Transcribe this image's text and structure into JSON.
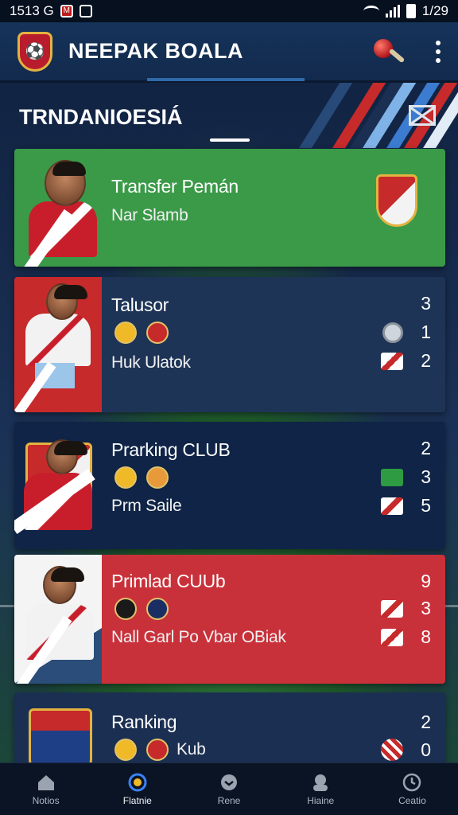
{
  "status_bar": {
    "left_text": "1513 G",
    "time": "1/29"
  },
  "app": {
    "title": "NEEPAK BOALA"
  },
  "section": {
    "title": "TRNDANIOESIÁ"
  },
  "cards": [
    {
      "title": "Transfer Pemán",
      "subtitle": "Nar Slamb",
      "color": "#3a9a48",
      "stats": []
    },
    {
      "title": "Talusor",
      "subtitle": "Huk Ulatok",
      "color": "#1e3456",
      "stats": [
        "3",
        "1",
        "2"
      ]
    },
    {
      "title": "Prarking CLUB",
      "subtitle": "Prm Saile",
      "color": "#0f2446",
      "stats": [
        "2",
        "3",
        "5"
      ]
    },
    {
      "title": "Primlad CUUb",
      "subtitle": "Nall Garl Po Vbar OBiak",
      "color": "#c9313a",
      "stats": [
        "9",
        "3",
        "8"
      ]
    },
    {
      "title": "Ranking",
      "subtitle": "Kub",
      "color": "#1b2f52",
      "stats": [
        "2",
        "0"
      ]
    }
  ],
  "nav": [
    {
      "label": "Notios",
      "icon": "home-icon"
    },
    {
      "label": "Flatnie",
      "icon": "ball-icon"
    },
    {
      "label": "Rene",
      "icon": "chat-icon"
    },
    {
      "label": "Hiaine",
      "icon": "people-icon"
    },
    {
      "label": "Ceatio",
      "icon": "clock-icon"
    }
  ]
}
